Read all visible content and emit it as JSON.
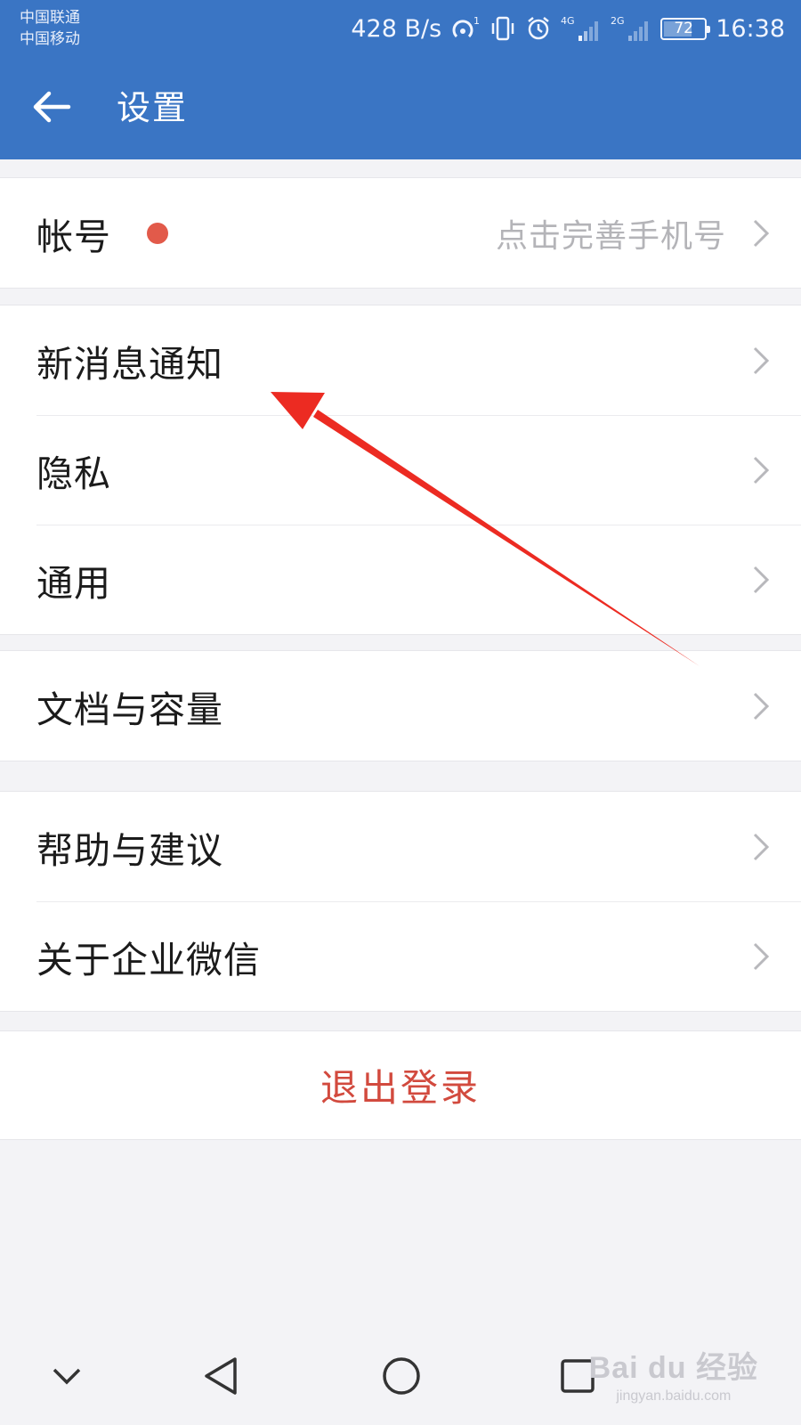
{
  "status_bar": {
    "carrier_1": "中国联通",
    "carrier_2": "中国移动",
    "net_speed": "428 B/s",
    "network_1": "4G",
    "network_2": "2G",
    "battery": "72",
    "battery_level": 0.72,
    "time": "16:38"
  },
  "header": {
    "title": "设置",
    "icons": {
      "back": "arrow-left-icon"
    }
  },
  "groups": [
    {
      "items": [
        {
          "label": "帐号",
          "badge": "red-dot",
          "value": "点击完善手机号"
        }
      ]
    },
    {
      "items": [
        {
          "label": "新消息通知"
        },
        {
          "label": "隐私"
        },
        {
          "label": "通用"
        }
      ]
    },
    {
      "items": [
        {
          "label": "文档与容量"
        }
      ]
    },
    {
      "items": [
        {
          "label": "帮助与建议"
        },
        {
          "label": "关于企业微信"
        }
      ]
    }
  ],
  "logout": {
    "label": "退出登录"
  },
  "nav_bar": {
    "icons": [
      "chevron-down-icon",
      "back-triangle-icon",
      "home-circle-icon",
      "recents-square-icon"
    ]
  },
  "watermark": {
    "main": "Bai du 经验",
    "sub": "jingyan.baidu.com"
  },
  "colors": {
    "app_bar": "#3a75c4",
    "background": "#f3f3f6",
    "logout_text": "#d24a3e",
    "red_dot": "#e25a4a",
    "annotation_arrow": "#ec2b22"
  }
}
